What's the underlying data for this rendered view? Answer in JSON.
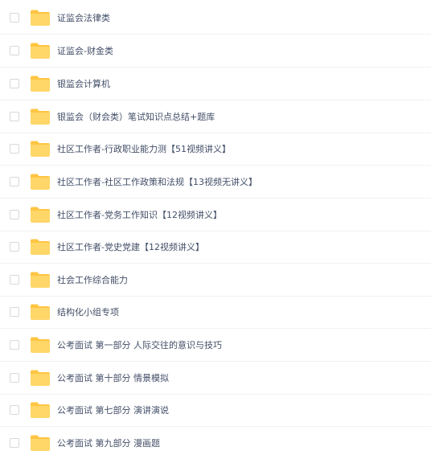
{
  "file_list": {
    "folder_color": "#ffd668",
    "folder_tab_color": "#ffc542",
    "items": [
      {
        "name": "证监会法律类",
        "icon": "folder-icon"
      },
      {
        "name": "证监会-财金类",
        "icon": "folder-icon"
      },
      {
        "name": "银监会计算机",
        "icon": "folder-icon"
      },
      {
        "name": "银监会（财会类）笔试知识点总结+题库",
        "icon": "folder-icon"
      },
      {
        "name": "社区工作者-行政职业能力测【51视频讲义】",
        "icon": "folder-icon"
      },
      {
        "name": "社区工作者-社区工作政策和法规【13视频无讲义】",
        "icon": "folder-icon"
      },
      {
        "name": "社区工作者-党务工作知识【12视频讲义】",
        "icon": "folder-icon"
      },
      {
        "name": "社区工作者-党史党建【12视频讲义】",
        "icon": "folder-icon"
      },
      {
        "name": "社会工作综合能力",
        "icon": "folder-icon"
      },
      {
        "name": "结构化小组专项",
        "icon": "folder-icon"
      },
      {
        "name": "公考面试 第一部分 人际交往的意识与技巧",
        "icon": "folder-icon"
      },
      {
        "name": "公考面试 第十部分 情景模拟",
        "icon": "folder-icon"
      },
      {
        "name": "公考面试 第七部分 演讲演说",
        "icon": "folder-icon"
      },
      {
        "name": "公考面试 第九部分 漫画题",
        "icon": "folder-icon"
      }
    ]
  }
}
